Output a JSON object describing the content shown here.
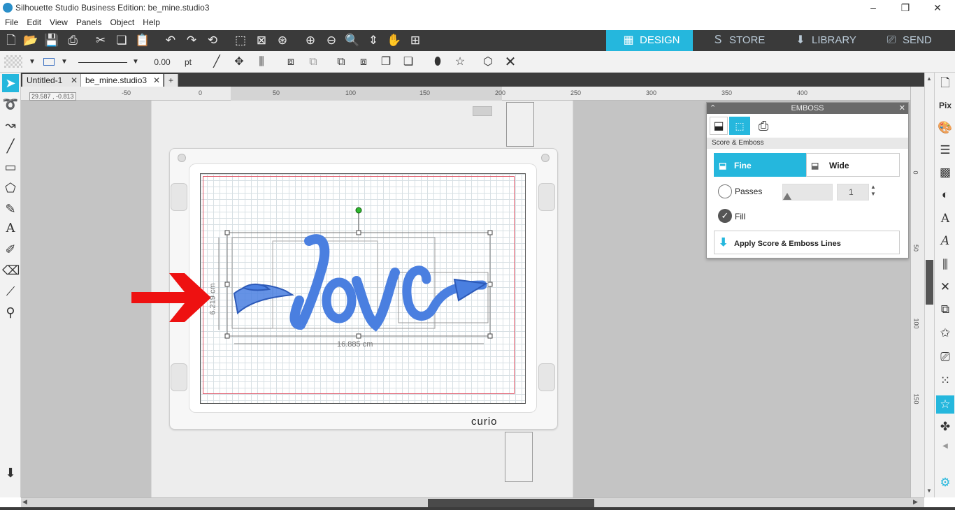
{
  "window": {
    "title": "Silhouette Studio Business Edition: be_mine.studio3"
  },
  "menu": [
    "File",
    "Edit",
    "View",
    "Panels",
    "Object",
    "Help"
  ],
  "nav_tabs": [
    {
      "label": "DESIGN",
      "icon": "grid-icon",
      "active": true
    },
    {
      "label": "STORE",
      "icon": "silhouette-s-icon",
      "active": false
    },
    {
      "label": "LIBRARY",
      "icon": "library-download-icon",
      "active": false
    },
    {
      "label": "SEND",
      "icon": "cutter-icon",
      "active": false
    }
  ],
  "toolbar2": {
    "line_width": "0.00",
    "line_unit": "pt"
  },
  "doc_tabs": [
    {
      "label": "Untitled-1",
      "active": false
    },
    {
      "label": "be_mine.studio3",
      "active": true
    }
  ],
  "ruler": {
    "coords": "29.587 , -0.813",
    "h_labels": [
      "-50",
      "0",
      "50",
      "100",
      "150",
      "200",
      "250",
      "300",
      "350",
      "400"
    ],
    "v_labels": [
      "0",
      "50",
      "100",
      "150"
    ]
  },
  "design": {
    "word": "love",
    "width_dim": "16.885 cm",
    "height_dim": "6.219 cm",
    "mat_brand": "curio",
    "design_color": "#4a7fe0",
    "arrow_color": "#ee1111"
  },
  "emboss_panel": {
    "title": "EMBOSS",
    "section": "Score & Emboss",
    "fine_label": "Fine",
    "wide_label": "Wide",
    "passes_label": "Passes",
    "passes_value": "1",
    "fill_label": "Fill",
    "apply_label": "Apply Score & Emboss Lines"
  }
}
